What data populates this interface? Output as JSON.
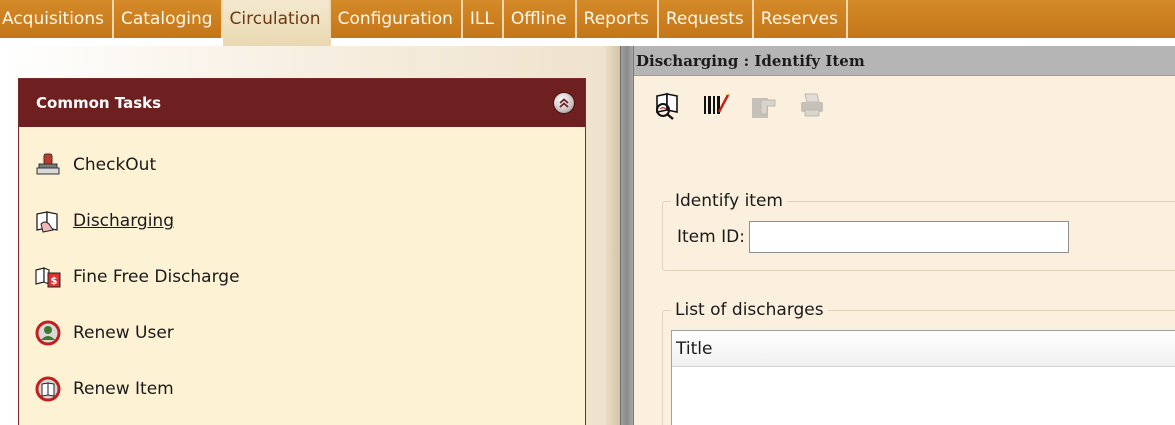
{
  "menubar": {
    "tabs": [
      {
        "label": "Acquisitions"
      },
      {
        "label": "Cataloging"
      },
      {
        "label": "Circulation"
      },
      {
        "label": "Configuration"
      },
      {
        "label": "ILL"
      },
      {
        "label": "Offline"
      },
      {
        "label": "Reports"
      },
      {
        "label": "Requests"
      },
      {
        "label": "Reserves"
      }
    ],
    "active_tab": "Circulation"
  },
  "common_tasks": {
    "title": "Common Tasks",
    "collapse_icon": "double-chevron-up-icon",
    "items": [
      {
        "label": "CheckOut",
        "icon": "stamp-icon"
      },
      {
        "label": "Discharging",
        "icon": "book-hand-icon",
        "selected": true
      },
      {
        "label": "Fine Free Discharge",
        "icon": "book-no-fine-icon"
      },
      {
        "label": "Renew User",
        "icon": "renew-user-icon"
      },
      {
        "label": "Renew Item",
        "icon": "renew-item-icon"
      }
    ]
  },
  "pane": {
    "title": "Discharging : Identify Item",
    "toolbar": [
      {
        "icon": "identify-item-icon",
        "enabled": true
      },
      {
        "icon": "barcode-icon",
        "enabled": true
      },
      {
        "icon": "hand-pointer-icon",
        "enabled": false
      },
      {
        "icon": "print-icon",
        "enabled": false
      }
    ],
    "identify_group": {
      "legend": "Identify item",
      "item_id_label": "Item ID:",
      "item_id_value": ""
    },
    "discharges_group": {
      "legend": "List of discharges",
      "columns": [
        "Title"
      ]
    }
  },
  "colors": {
    "menubar": "#c97d1f",
    "tasks_header": "#6e1f20",
    "tasks_body": "#fdf2d4",
    "pane_bg": "#fbf0dd"
  }
}
